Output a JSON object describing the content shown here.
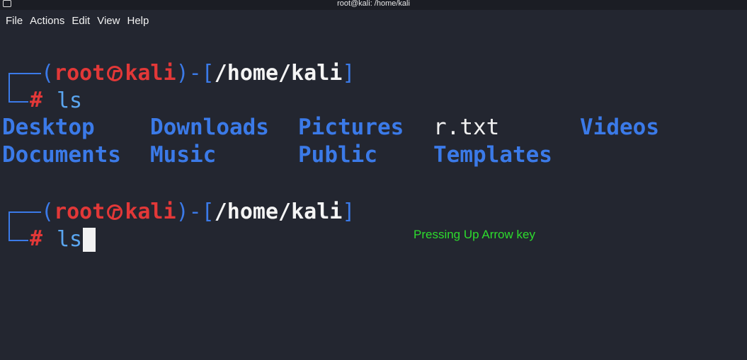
{
  "window": {
    "title": "root@kali: /home/kali"
  },
  "menu": [
    "File",
    "Actions",
    "Edit",
    "View",
    "Help"
  ],
  "prompts": [
    {
      "user": "root",
      "host": "kali",
      "path": "/home/kali",
      "command": "ls"
    },
    {
      "user": "root",
      "host": "kali",
      "path": "/home/kali",
      "command": "ls"
    }
  ],
  "listing": {
    "row1": [
      "Desktop",
      "Downloads",
      "Pictures",
      "r.txt",
      "Videos"
    ],
    "row2": [
      "Documents",
      "Music",
      "Public",
      "Templates"
    ]
  },
  "annotation": "Pressing Up Arrow key",
  "colors": {
    "background": "#232630",
    "prompt_blue": "#3b7ae8",
    "prompt_red": "#e23838",
    "annotation_green": "#2ddc2d"
  }
}
